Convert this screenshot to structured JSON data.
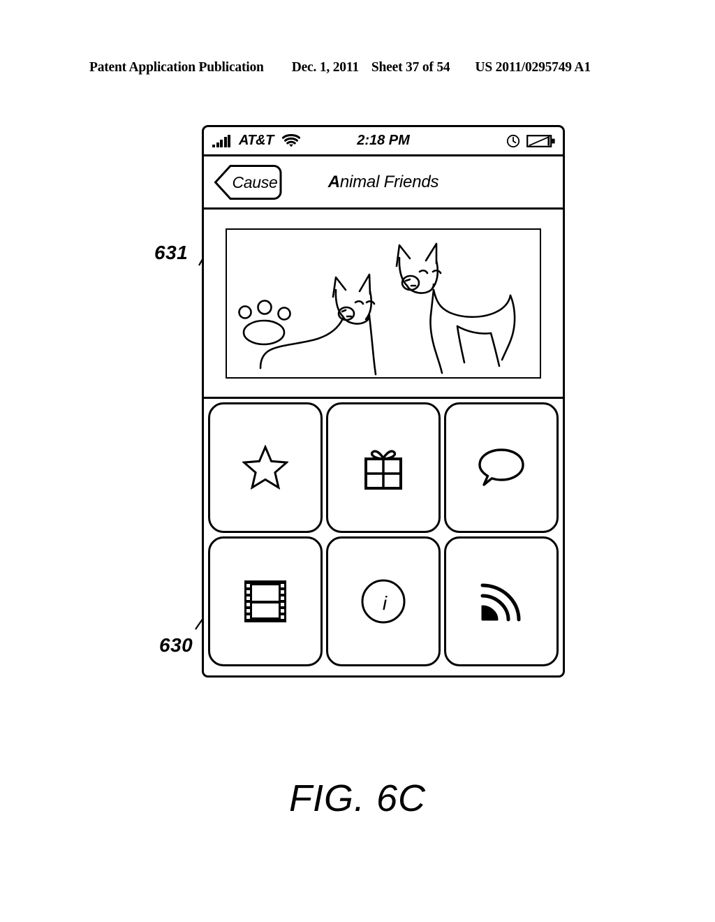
{
  "document": {
    "header": {
      "publication": "Patent Application Publication",
      "date": "Dec. 1, 2011",
      "sheet": "Sheet 37 of 54",
      "number": "US 2011/0295749 A1"
    },
    "figure_caption": "FIG. 6C",
    "reference_numerals": [
      {
        "id": "ref-631",
        "label": "631",
        "points_to": "back-button"
      },
      {
        "id": "ref-630",
        "label": "630",
        "points_to": "icon-grid"
      }
    ]
  },
  "device": {
    "status_bar": {
      "signal_icon": "signal-bars-icon",
      "signal_bars": 5,
      "carrier": "AT&T",
      "wifi_icon": "wifi-icon",
      "time": "2:18 PM",
      "alarm_icon": "alarm-clock-icon",
      "battery_icon": "battery-icon"
    },
    "nav_bar": {
      "back_label": "Cause",
      "back_icon": "chevron-left-icon",
      "title_lead": "A",
      "title_rest": "nimal Friends",
      "title_full": "Animal Friends"
    },
    "hero": {
      "name": "animal-photo",
      "description": "Line drawing of two dogs with a paw print",
      "elements": [
        "paw-print",
        "dog-front",
        "dog-back"
      ]
    },
    "grid": {
      "name": "icon-grid",
      "columns": 3,
      "rows": 2,
      "tiles": [
        {
          "name": "tile-favorites",
          "icon": "star-icon"
        },
        {
          "name": "tile-gifts",
          "icon": "gift-icon"
        },
        {
          "name": "tile-comments",
          "icon": "speech-bubble-icon"
        },
        {
          "name": "tile-photos",
          "icon": "film-strip-icon"
        },
        {
          "name": "tile-info",
          "icon": "info-circle-icon",
          "glyph": "i"
        },
        {
          "name": "tile-feed",
          "icon": "rss-feed-icon"
        }
      ]
    }
  },
  "colors": {
    "ink": "#000000",
    "paper": "#ffffff"
  }
}
